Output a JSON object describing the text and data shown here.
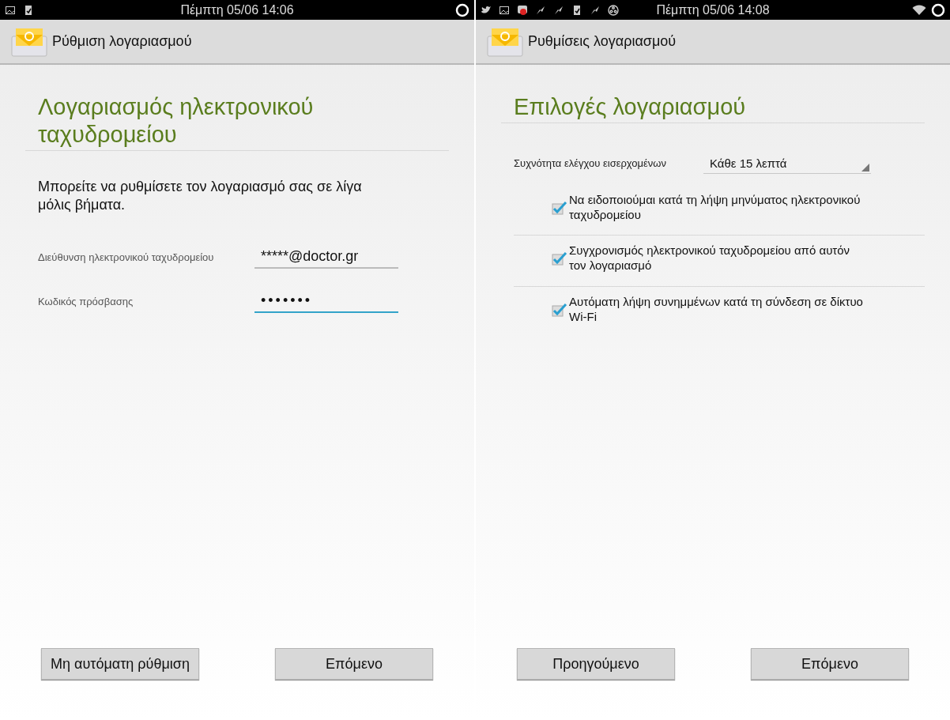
{
  "screens": [
    {
      "status_bar": {
        "time": "Πέμπτη 05/06 14:06"
      },
      "action_bar": {
        "title": "Ρύθμιση λογαριασμού"
      },
      "heading": "Λογαριασμός ηλεκτρονικού ταχυδρομείου",
      "intro": "Μπορείτε να ρυθμίσετε τον λογαριασμό σας σε λίγα μόλις βήματα.",
      "fields": [
        {
          "label": "Διεύθυνση ηλεκτρονικού ταχυδρομείου",
          "value": "*****@doctor.gr",
          "focused": false
        },
        {
          "label": "Κωδικός πρόσβασης",
          "value": "•••••••",
          "focused": true
        }
      ],
      "buttons": [
        "Μη αυτόματη ρύθμιση",
        "Επόμενο"
      ]
    },
    {
      "status_bar": {
        "time": "Πέμπτη 05/06 14:08"
      },
      "action_bar": {
        "title": "Ρυθμίσεις λογαριασμού"
      },
      "heading": "Επιλογές λογαριασμού",
      "setting": {
        "label": "Συχνότητα ελέγχου εισερχομένων",
        "value": "Κάθε 15 λεπτά"
      },
      "options": [
        {
          "label": "Να ειδοποιούμαι κατά τη λήψη μηνύματος ηλεκτρονικού ταχυδρομείου",
          "checked": true
        },
        {
          "label": "Συγχρονισμός ηλεκτρονικού ταχυδρομείου από αυτόν τον λογαριασμό",
          "checked": true
        },
        {
          "label": "Αυτόματη λήψη συνημμένων κατά τη σύνδεση σε δίκτυο Wi-Fi",
          "checked": true
        }
      ],
      "buttons": [
        "Προηγούμενο",
        "Επόμενο"
      ]
    }
  ]
}
